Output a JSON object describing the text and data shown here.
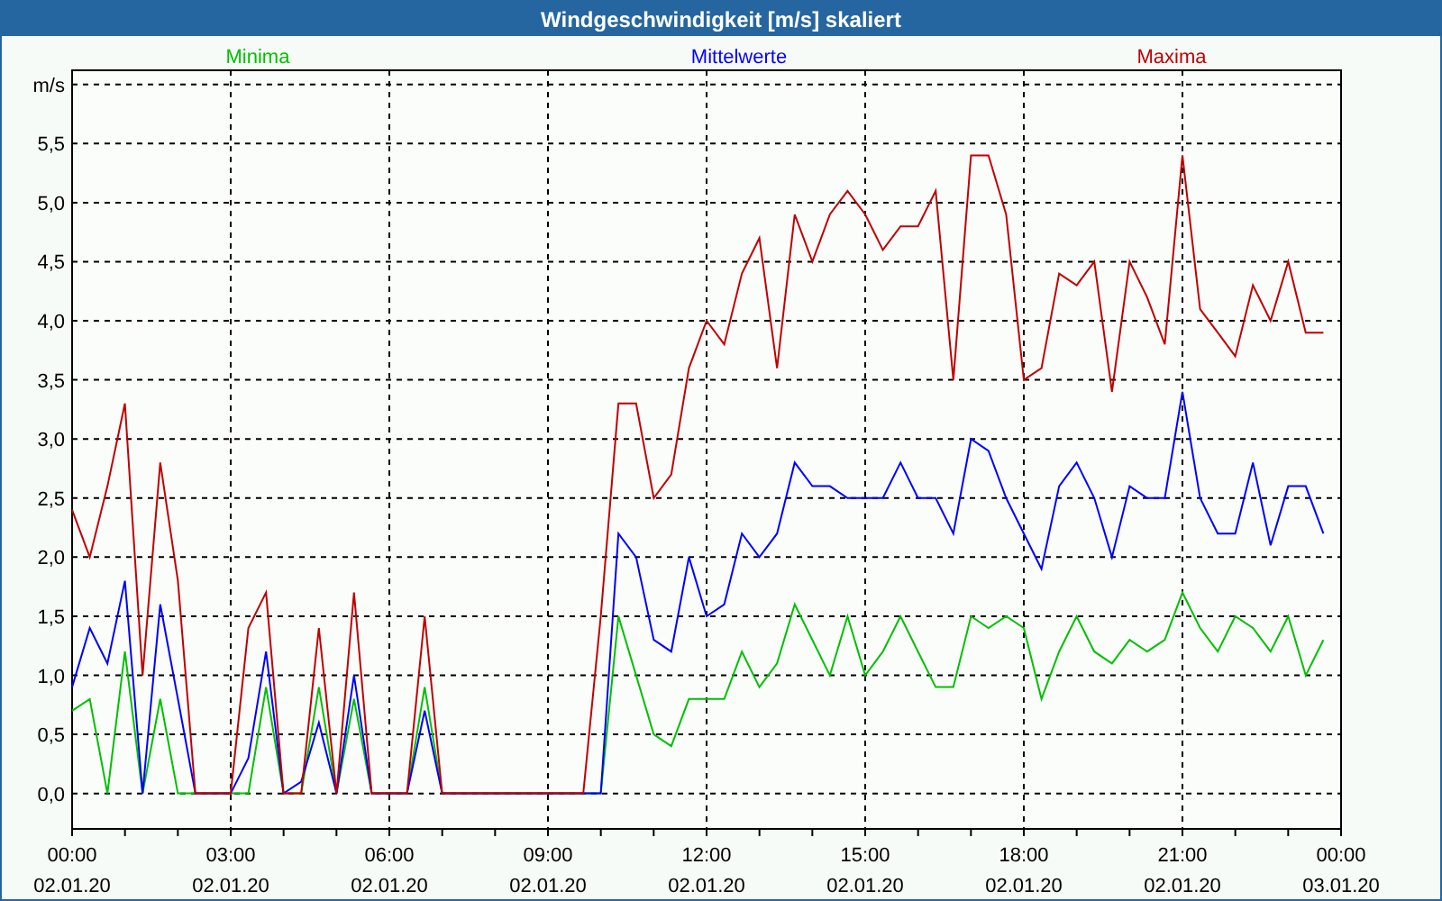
{
  "window": {
    "title": "Windgeschwindigkeit [m/s] skaliert"
  },
  "chart": {
    "chart_data": {
      "type": "line",
      "ylabel": "m/s",
      "categories": [
        "00:00 02.01.20",
        null,
        null,
        null,
        null,
        null,
        null,
        null,
        null,
        "03:00 02.01.20",
        null,
        null,
        null,
        null,
        null,
        null,
        null,
        null,
        "06:00 02.01.20",
        null,
        null,
        null,
        null,
        null,
        null,
        null,
        null,
        "09:00 02.01.20",
        null,
        null,
        null,
        null,
        null,
        null,
        null,
        null,
        "12:00 02.01.20",
        null,
        null,
        null,
        null,
        null,
        null,
        null,
        null,
        "15:00 02.01.20",
        null,
        null,
        null,
        null,
        null,
        null,
        null,
        null,
        "18:00 02.01.20",
        null,
        null,
        null,
        null,
        null,
        null,
        null,
        null,
        "21:00 02.01.20",
        null,
        null,
        null,
        null,
        null,
        null,
        null,
        null,
        "00:00 03.01.20"
      ],
      "series": [
        {
          "name": "Minima",
          "color": "#00c000",
          "values": [
            0.7,
            0.8,
            0,
            1.2,
            0,
            0.8,
            0,
            0,
            0,
            0,
            0,
            0.9,
            0,
            0,
            0.9,
            0,
            0.8,
            0,
            0,
            0,
            0.9,
            0,
            0,
            0,
            0,
            0,
            0,
            0,
            0,
            0,
            0,
            1.5,
            1.0,
            0.5,
            0.4,
            0.8,
            0.8,
            0.8,
            1.2,
            0.9,
            1.1,
            1.6,
            1.3,
            1.0,
            1.5,
            1.0,
            1.2,
            1.5,
            1.2,
            0.9,
            0.9,
            1.5,
            1.4,
            1.5,
            1.4,
            0.8,
            1.2,
            1.5,
            1.2,
            1.1,
            1.3,
            1.2,
            1.3,
            1.7,
            1.4,
            1.2,
            1.5,
            1.4,
            1.2,
            1.5,
            1.0,
            1.3,
            null
          ]
        },
        {
          "name": "Mittelwerte",
          "color": "#0000ff",
          "values": [
            0.9,
            1.4,
            1.1,
            1.8,
            0,
            1.6,
            0.8,
            0,
            0,
            0,
            0.3,
            1.2,
            0,
            0.1,
            0.6,
            0,
            1.0,
            0,
            0,
            0,
            0.7,
            0,
            0,
            0,
            0,
            0,
            0,
            0,
            0,
            0,
            0,
            2.2,
            2.0,
            1.3,
            1.2,
            2.0,
            1.5,
            1.6,
            2.2,
            2.0,
            2.2,
            2.8,
            2.6,
            2.6,
            2.5,
            2.5,
            2.5,
            2.8,
            2.5,
            2.5,
            2.2,
            3.0,
            2.9,
            2.5,
            2.2,
            1.9,
            2.6,
            2.8,
            2.5,
            2.0,
            2.6,
            2.5,
            2.5,
            3.4,
            2.5,
            2.2,
            2.2,
            2.8,
            2.1,
            2.6,
            2.6,
            2.2,
            null
          ]
        },
        {
          "name": "Maxima",
          "color": "#c00000",
          "values": [
            2.4,
            2.0,
            2.6,
            3.3,
            1.0,
            2.8,
            1.8,
            0,
            0,
            0,
            1.4,
            1.7,
            0,
            0,
            1.4,
            0,
            1.7,
            0,
            0,
            0,
            1.5,
            0,
            0,
            0,
            0,
            0,
            0,
            0,
            0,
            0,
            1.5,
            3.3,
            3.3,
            2.5,
            2.7,
            3.6,
            4.0,
            3.8,
            4.4,
            4.7,
            3.6,
            4.9,
            4.5,
            4.9,
            5.1,
            4.9,
            4.6,
            4.8,
            4.8,
            5.1,
            3.5,
            5.4,
            5.4,
            4.9,
            3.5,
            3.6,
            4.4,
            4.3,
            4.5,
            3.4,
            4.5,
            4.2,
            3.8,
            5.4,
            4.1,
            3.9,
            3.7,
            4.3,
            4.0,
            4.5,
            3.9,
            3.9,
            null
          ]
        }
      ],
      "ylim": [
        -0.3,
        6.12
      ],
      "grid": true,
      "yticks": [
        {
          "value": 0,
          "label": "0,0"
        },
        {
          "value": 0.5,
          "label": "0,5"
        },
        {
          "value": 1,
          "label": "1,0"
        },
        {
          "value": 1.5,
          "label": "1,5"
        },
        {
          "value": 2,
          "label": "2,0"
        },
        {
          "value": 2.5,
          "label": "2,5"
        },
        {
          "value": 3,
          "label": "3,0"
        },
        {
          "value": 3.5,
          "label": "3,5"
        },
        {
          "value": 4,
          "label": "4,0"
        },
        {
          "value": 4.5,
          "label": "4,5"
        },
        {
          "value": 5,
          "label": "5,0"
        },
        {
          "value": 5.5,
          "label": "5,5"
        }
      ]
    }
  }
}
